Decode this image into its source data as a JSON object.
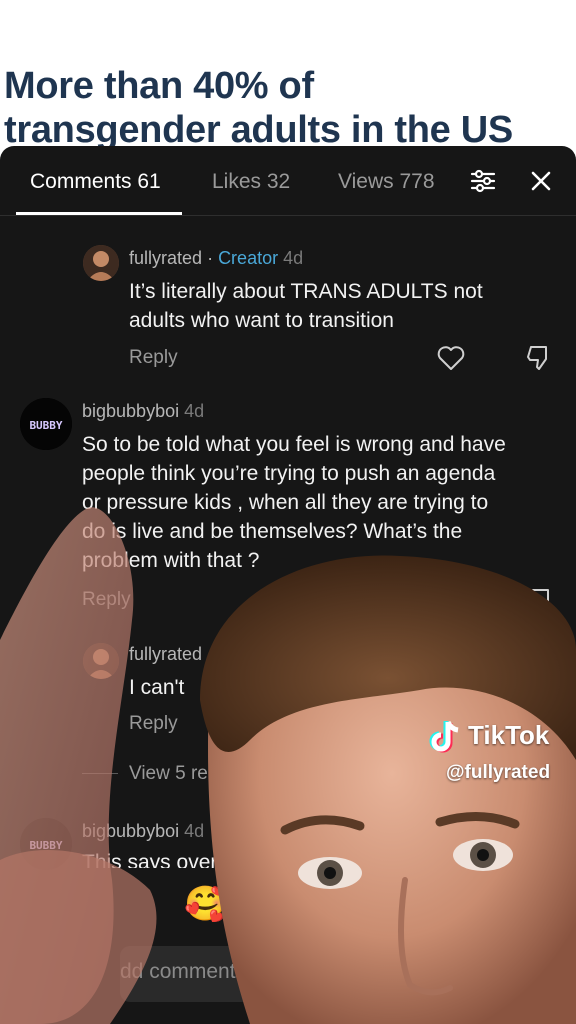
{
  "background": {
    "headline_line1": "More than 40% of",
    "headline_line2": "transgender adults in the US"
  },
  "tabs": {
    "comments": "Comments 61",
    "likes": "Likes 32",
    "views": "Views 778",
    "active": "comments",
    "filter_icon": "filter-sliders-icon",
    "close_icon": "close-icon"
  },
  "comments": [
    {
      "user": "fullyrated",
      "badge": "Creator",
      "time": "4d",
      "text_line1": "It’s literally about TRANS ADULTS not",
      "text_line2": "adults who want to transition",
      "reply": "Reply"
    },
    {
      "user": "bigbubbyboi",
      "avatar_text": "BUBBY",
      "time": "4d",
      "text_line1": "So to be told what you feel is wrong and have",
      "text_line2": "people think you’re trying to push an agenda",
      "text_line3": "or pressure kids , when all they are trying to",
      "text_line4": "do is live and be themselves? What’s the",
      "text_line5": "problem with that ?",
      "reply": "Reply"
    },
    {
      "user": "fullyrated",
      "text": "I can't",
      "reply": "Reply"
    },
    {
      "view_more": "View 5 re"
    },
    {
      "user": "bigbubbyboi",
      "avatar_text": "BUBBY",
      "time": "4d",
      "text": "This says over"
    }
  ],
  "reactions": {
    "emoji": "🥰"
  },
  "composer": {
    "placeholder": "dd comment..."
  },
  "watermark": {
    "brand": "TikTok",
    "handle": "@fullyrated"
  },
  "colors": {
    "sheet_bg": "#161616",
    "creator_badge": "#4aa8d8",
    "headline": "#1f3550"
  }
}
